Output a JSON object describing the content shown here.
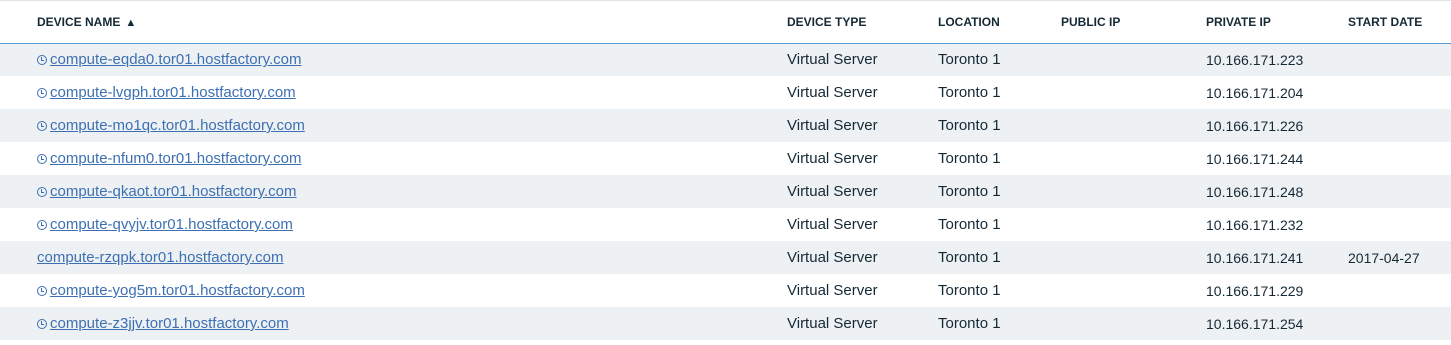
{
  "columns": {
    "device_name": "DEVICE NAME",
    "sort_indicator": "▲",
    "device_type": "DEVICE TYPE",
    "location": "LOCATION",
    "public_ip": "PUBLIC IP",
    "private_ip": "PRIVATE IP",
    "start_date": "START DATE"
  },
  "rows": [
    {
      "name": "compute-eqda0.tor01.hostfactory.com",
      "has_clock": true,
      "type": "Virtual Server",
      "location": "Toronto 1",
      "public_ip": "",
      "private_ip": "10.166.171.223",
      "start_date": ""
    },
    {
      "name": "compute-lvgph.tor01.hostfactory.com",
      "has_clock": true,
      "type": "Virtual Server",
      "location": "Toronto 1",
      "public_ip": "",
      "private_ip": "10.166.171.204",
      "start_date": ""
    },
    {
      "name": "compute-mo1qc.tor01.hostfactory.com",
      "has_clock": true,
      "type": "Virtual Server",
      "location": "Toronto 1",
      "public_ip": "",
      "private_ip": "10.166.171.226",
      "start_date": ""
    },
    {
      "name": "compute-nfum0.tor01.hostfactory.com",
      "has_clock": true,
      "type": "Virtual Server",
      "location": "Toronto 1",
      "public_ip": "",
      "private_ip": "10.166.171.244",
      "start_date": ""
    },
    {
      "name": "compute-qkaot.tor01.hostfactory.com",
      "has_clock": true,
      "type": "Virtual Server",
      "location": "Toronto 1",
      "public_ip": "",
      "private_ip": "10.166.171.248",
      "start_date": ""
    },
    {
      "name": "compute-qvyjv.tor01.hostfactory.com",
      "has_clock": true,
      "type": "Virtual Server",
      "location": "Toronto 1",
      "public_ip": "",
      "private_ip": "10.166.171.232",
      "start_date": ""
    },
    {
      "name": "compute-rzqpk.tor01.hostfactory.com",
      "has_clock": false,
      "type": "Virtual Server",
      "location": "Toronto 1",
      "public_ip": "",
      "private_ip": "10.166.171.241",
      "start_date": "2017-04-27"
    },
    {
      "name": "compute-yog5m.tor01.hostfactory.com",
      "has_clock": true,
      "type": "Virtual Server",
      "location": "Toronto 1",
      "public_ip": "",
      "private_ip": "10.166.171.229",
      "start_date": ""
    },
    {
      "name": "compute-z3jjv.tor01.hostfactory.com",
      "has_clock": true,
      "type": "Virtual Server",
      "location": "Toronto 1",
      "public_ip": "",
      "private_ip": "10.166.171.254",
      "start_date": ""
    }
  ],
  "colors": {
    "link": "#3d70b2",
    "header_border": "#5a9bd5",
    "stripe": "#eef1f4",
    "text": "#152935"
  },
  "icons": {
    "pending": "clock-icon"
  }
}
